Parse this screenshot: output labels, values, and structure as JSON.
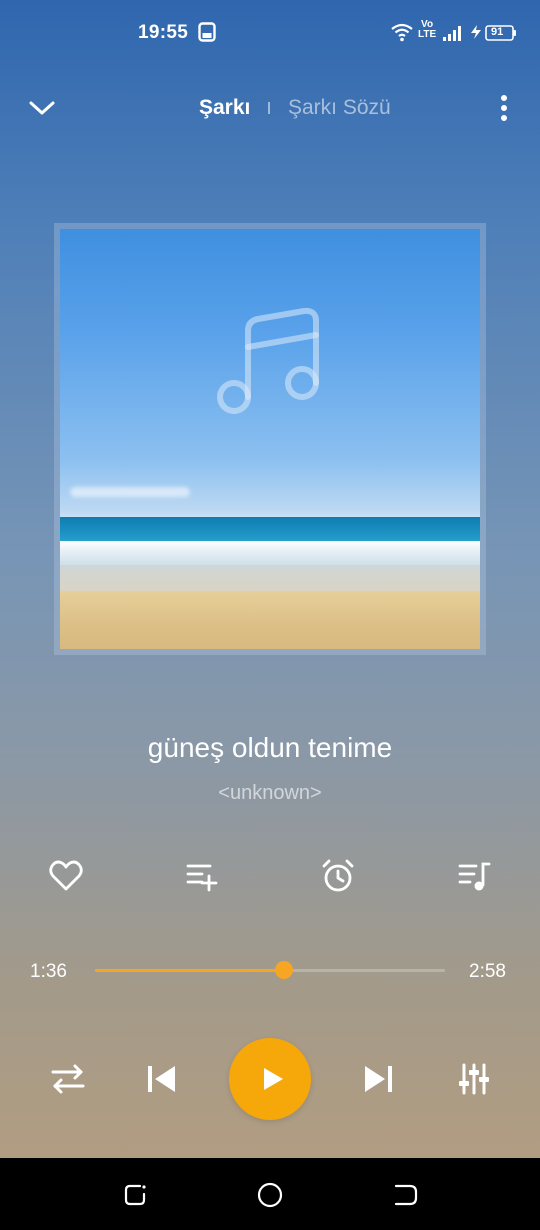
{
  "status_bar": {
    "time": "19:55",
    "network_label_top": "Vo",
    "network_label_bottom": "LTE",
    "battery": "91"
  },
  "header": {
    "tab_song": "Şarkı",
    "tab_lyrics": "Şarkı Sözü"
  },
  "song": {
    "title": "güneş oldun tenime",
    "artist": "<unknown>"
  },
  "progress": {
    "current": "1:36",
    "total": "2:58",
    "fraction": 0.54
  },
  "colors": {
    "accent": "#f6a70a"
  },
  "icons": [
    "chevron-down-icon",
    "more-vert-icon",
    "music-note-icon",
    "heart-icon",
    "add-to-playlist-icon",
    "alarm-icon",
    "queue-icon",
    "repeat-icon",
    "previous-icon",
    "play-icon",
    "next-icon",
    "equalizer-icon",
    "recent-apps-icon",
    "home-icon",
    "back-icon"
  ]
}
